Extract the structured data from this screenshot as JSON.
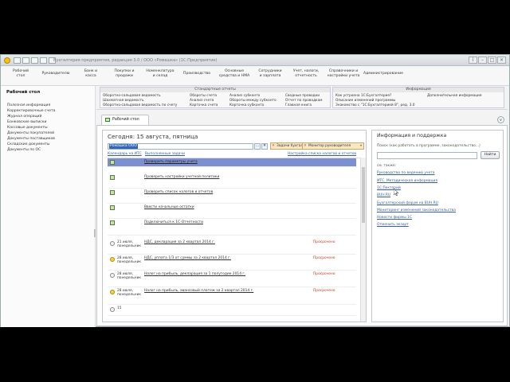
{
  "window": {
    "title": "Бухгалтерия предприятия, редакция 3.0 / ООО «Ромашка»  (1С:Предприятие)"
  },
  "sections": [
    {
      "id": "desktop",
      "label": "Рабочий\nстол"
    },
    {
      "id": "management",
      "label": "Руководителю"
    },
    {
      "id": "bank",
      "label": "Банк и\nкасса"
    },
    {
      "id": "sales",
      "label": "Покупки и\nпродажи"
    },
    {
      "id": "warehouse",
      "label": "Номенклатура\nи склад"
    },
    {
      "id": "production",
      "label": "Производство"
    },
    {
      "id": "assets",
      "label": "Основные\nсредства и НМА"
    },
    {
      "id": "salary",
      "label": "Сотрудники\nи зарплата"
    },
    {
      "id": "reports",
      "label": "Учет, налоги,\nотчетность"
    },
    {
      "id": "settings",
      "label": "Справочники и\nнастройки учета"
    },
    {
      "id": "admin",
      "label": "Администрирование"
    }
  ],
  "function_panel": {
    "standard_reports": {
      "title": "Стандартные отчеты",
      "col1": [
        "Оборотно-сальдовая ведомость",
        "Шахматная ведомость",
        "Оборотно-сальдовая ведомость по счету"
      ],
      "col2": [
        "Обороты счета",
        "Анализ счета",
        "Карточка счета"
      ],
      "col3": [
        "Анализ субконто",
        "Обороты между субконто",
        "Карточка субконто"
      ],
      "col4": [
        "Сводные проводки",
        "Отчет по проводкам",
        "Главная книга"
      ]
    },
    "info": {
      "title": "Информация",
      "items": [
        "Как устроена 1С:Бухгалтерия?",
        "Описание изменений программы",
        "Знакомство с \"1С:Бухгалтерией 8\", ред. 3.0"
      ],
      "extra": "Дополнительная информация"
    }
  },
  "nav": {
    "header": "Рабочий стол",
    "items": [
      "Полезная информация",
      "Корректировочные счета",
      "Журнал операций",
      "Банковские выписки",
      "Кассовые документы",
      "Документы покупателей",
      "Документы поставщиков",
      "Складские документы",
      "Документы по ОС"
    ]
  },
  "tab": {
    "label": "Рабочий стол",
    "collapse": "∨"
  },
  "today": {
    "heading": "Сегодня: 15 августа, пятница",
    "org_value": "Ромашка ООО",
    "org_btn_dots": "...",
    "org_btn_x": "✕",
    "tag_accountant": "Задачи бухгалтера",
    "tag_manager": "Монитор руководителя",
    "tag_close": "✕",
    "tag_dropdown": "▾",
    "link_calendar": "Календарь на ИТС",
    "link_done": "Выполненные задачи",
    "link_settings": "Настройка списка налогов и отчетов"
  },
  "tasks": [
    {
      "icon": "doc",
      "date": "",
      "text": "Проверить параметры учета",
      "status": "",
      "selected": true
    },
    {
      "icon": "doc",
      "date": "",
      "text": "Проверить настройки учетной политики",
      "status": "",
      "selected": false
    },
    {
      "icon": "doc",
      "date": "",
      "text": "Проверить список налогов и отчетов",
      "status": "",
      "selected": false
    },
    {
      "icon": "doc",
      "date": "",
      "text": "Ввести начальные остатки",
      "status": "",
      "selected": false
    },
    {
      "icon": "doc",
      "date": "",
      "text": "Подключиться к 1С-Отчетности",
      "status": "",
      "selected": false
    },
    {
      "icon": "clock",
      "date": "21 июля,\nпонедельник",
      "text": "НДС, декларация за 2 квартал 2014 г.",
      "status": "Просрочено",
      "selected": false
    },
    {
      "icon": "warn",
      "date": "28 июля,\nпонедельник",
      "text": "НДС, уплата 1/3 от суммы за 2 квартал 2014 г.",
      "status": "Просрочено",
      "selected": false
    },
    {
      "icon": "clock",
      "date": "28 июля,\nпонедельник",
      "text": "Налог на прибыль, декларация за 1 полугодие 2014 г.",
      "status": "Просрочено",
      "selected": false
    },
    {
      "icon": "warn",
      "date": "28 июля,\nпонедельник",
      "text": "Налог на прибыль, авансовый платеж за 2 квартал 2014 г.",
      "status": "Просрочено",
      "selected": false
    },
    {
      "icon": "clock",
      "date": "15",
      "text": "",
      "status": "",
      "selected": false
    }
  ],
  "support": {
    "title": "Информация и поддержка",
    "search_hint": "Поиск (как работать в программе, законодательство...)",
    "find_button": "Найти",
    "see_also": "см. также:",
    "links": [
      "Руководство по ведению учета",
      "ИТС. Методическая информация",
      "1С:Лекторий",
      "BUH.RU",
      "Бухгалтерский форум на BUH.RU",
      "Мониторинг изменений законодательства",
      "Новости фирмы 1С",
      "Отменить экзорт"
    ]
  },
  "colors": {
    "selected_row": "#7c8fd1",
    "overdue": "#c0392b",
    "link": "#3a5f9c"
  }
}
